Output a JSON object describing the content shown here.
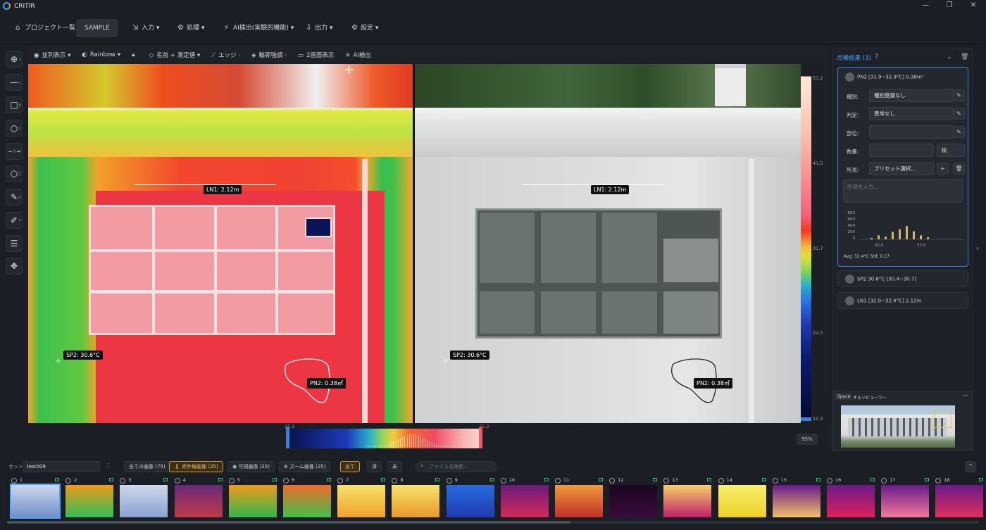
{
  "app": {
    "title": "CRITIR"
  },
  "menu": [
    {
      "label": "プロジェクト一覧",
      "icon": "home-icon"
    },
    {
      "label": "SAMPLE",
      "icon": ""
    },
    {
      "label": "入力 ▾",
      "icon": "import-icon"
    },
    {
      "label": "処理 ▾",
      "icon": "process-icon"
    },
    {
      "label": "AI検出(実験的機能) ▾",
      "icon": "ai-icon"
    },
    {
      "label": "出力 ▾",
      "icon": "export-icon"
    },
    {
      "label": "設定 ▾",
      "icon": "gear-icon"
    }
  ],
  "viewbar": [
    {
      "label": "並列表示 ▾",
      "icon": "eye-icon"
    },
    {
      "label": "Rainbow ▾",
      "icon": "palette-icon"
    },
    {
      "label": "",
      "icon": "lock-icon"
    },
    {
      "label": "名前 + 測定値 ▾",
      "icon": "tag-icon"
    },
    {
      "label": "エッジ ·",
      "icon": "edge-icon"
    },
    {
      "label": "輪郭強調 ·",
      "icon": "contour-icon"
    },
    {
      "label": "2画面表示",
      "icon": "monitor-icon"
    },
    {
      "label": "AI検出",
      "icon": "ai-icon"
    }
  ],
  "tools": [
    {
      "name": "crosshair",
      "sub": "1"
    },
    {
      "name": "line",
      "sub": "L"
    },
    {
      "name": "rect",
      "sub": "B"
    },
    {
      "name": "circle",
      "sub": "C"
    },
    {
      "name": "point",
      "sub": "P"
    },
    {
      "name": "polygon",
      "sub": "G"
    },
    {
      "name": "pen",
      "sub": "D"
    },
    {
      "name": "edit",
      "sub": "F"
    },
    {
      "name": "sliders",
      "sub": ""
    },
    {
      "name": "move",
      "sub": ""
    }
  ],
  "annotations": {
    "line": "LN1: 2.12m",
    "spot": "SP2: 30.6°C",
    "polygon": "PN2: 0.38㎡"
  },
  "scale": {
    "max": "51.2",
    "t1": "41.5",
    "t2": "31.7",
    "t3": "22.0",
    "min": "12.3"
  },
  "histogram": {
    "low": "25.2",
    "high": "35.2"
  },
  "zoom": "95%",
  "panel": {
    "title": "点検結果 (3)",
    "cards": [
      {
        "title": "PN2  [31.9~32.9°C] 0.38m²",
        "selected": true
      },
      {
        "title": "SP2  30.6°C [30.4~30.7]",
        "selected": false
      },
      {
        "title": "LN1  [32.0~32.4°C] 2.12m",
        "selected": false
      }
    ],
    "fields": {
      "kind_label": "種別:",
      "kind_value": "種別登録なし",
      "judge_label": "判定:",
      "judge_value": "異常なし",
      "part_label": "部位:",
      "part_value": "",
      "qty_label": "数量:",
      "qty_value": "",
      "qty_unit": "枚",
      "remark_label": "所見:",
      "remark_value": "プリセット選択...",
      "remark_placeholder": "所見を入力..."
    },
    "hist": {
      "y": [
        "800",
        "600",
        "400",
        "200",
        "0"
      ],
      "x": [
        "32.0",
        "32.5"
      ],
      "stats": "Avg: 32.4°C   Std: 0.17"
    },
    "minimap": {
      "space": "Space",
      "label": "オルソビューワー"
    }
  },
  "filters": {
    "set_label": "セット:",
    "set_value": "test009",
    "all": "全ての画像 (75)",
    "ir": "赤外線画像 (25)",
    "visible": "可視画像 (25)",
    "zoom": "ズーム画像 (25)",
    "flag_all": "全て",
    "flag_done": "済",
    "flag_todo": "未",
    "search_placeholder": "ファイル名検索..."
  },
  "thumbs": [
    "1",
    "2",
    "3",
    "4",
    "5",
    "6",
    "7",
    "8",
    "9",
    "10",
    "11",
    "12",
    "13",
    "14",
    "15",
    "16",
    "17",
    "18"
  ],
  "colors": {
    "accent": "#4aa8ff",
    "filterOn": "#d99a2c",
    "bg": "#1b1e24"
  }
}
